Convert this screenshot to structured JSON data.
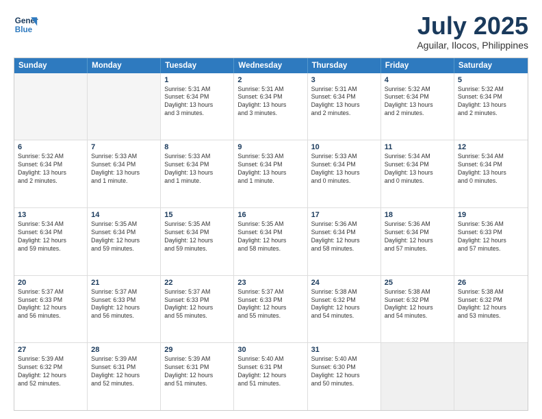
{
  "header": {
    "logo_line1": "General",
    "logo_line2": "Blue",
    "main_title": "July 2025",
    "subtitle": "Aguilar, Ilocos, Philippines"
  },
  "weekdays": [
    "Sunday",
    "Monday",
    "Tuesday",
    "Wednesday",
    "Thursday",
    "Friday",
    "Saturday"
  ],
  "rows": [
    [
      {
        "day": "",
        "lines": [],
        "empty": true
      },
      {
        "day": "",
        "lines": [],
        "empty": true
      },
      {
        "day": "1",
        "lines": [
          "Sunrise: 5:31 AM",
          "Sunset: 6:34 PM",
          "Daylight: 13 hours",
          "and 3 minutes."
        ]
      },
      {
        "day": "2",
        "lines": [
          "Sunrise: 5:31 AM",
          "Sunset: 6:34 PM",
          "Daylight: 13 hours",
          "and 3 minutes."
        ]
      },
      {
        "day": "3",
        "lines": [
          "Sunrise: 5:31 AM",
          "Sunset: 6:34 PM",
          "Daylight: 13 hours",
          "and 2 minutes."
        ]
      },
      {
        "day": "4",
        "lines": [
          "Sunrise: 5:32 AM",
          "Sunset: 6:34 PM",
          "Daylight: 13 hours",
          "and 2 minutes."
        ]
      },
      {
        "day": "5",
        "lines": [
          "Sunrise: 5:32 AM",
          "Sunset: 6:34 PM",
          "Daylight: 13 hours",
          "and 2 minutes."
        ]
      }
    ],
    [
      {
        "day": "6",
        "lines": [
          "Sunrise: 5:32 AM",
          "Sunset: 6:34 PM",
          "Daylight: 13 hours",
          "and 2 minutes."
        ]
      },
      {
        "day": "7",
        "lines": [
          "Sunrise: 5:33 AM",
          "Sunset: 6:34 PM",
          "Daylight: 13 hours",
          "and 1 minute."
        ]
      },
      {
        "day": "8",
        "lines": [
          "Sunrise: 5:33 AM",
          "Sunset: 6:34 PM",
          "Daylight: 13 hours",
          "and 1 minute."
        ]
      },
      {
        "day": "9",
        "lines": [
          "Sunrise: 5:33 AM",
          "Sunset: 6:34 PM",
          "Daylight: 13 hours",
          "and 1 minute."
        ]
      },
      {
        "day": "10",
        "lines": [
          "Sunrise: 5:33 AM",
          "Sunset: 6:34 PM",
          "Daylight: 13 hours",
          "and 0 minutes."
        ]
      },
      {
        "day": "11",
        "lines": [
          "Sunrise: 5:34 AM",
          "Sunset: 6:34 PM",
          "Daylight: 13 hours",
          "and 0 minutes."
        ]
      },
      {
        "day": "12",
        "lines": [
          "Sunrise: 5:34 AM",
          "Sunset: 6:34 PM",
          "Daylight: 13 hours",
          "and 0 minutes."
        ]
      }
    ],
    [
      {
        "day": "13",
        "lines": [
          "Sunrise: 5:34 AM",
          "Sunset: 6:34 PM",
          "Daylight: 12 hours",
          "and 59 minutes."
        ]
      },
      {
        "day": "14",
        "lines": [
          "Sunrise: 5:35 AM",
          "Sunset: 6:34 PM",
          "Daylight: 12 hours",
          "and 59 minutes."
        ]
      },
      {
        "day": "15",
        "lines": [
          "Sunrise: 5:35 AM",
          "Sunset: 6:34 PM",
          "Daylight: 12 hours",
          "and 59 minutes."
        ]
      },
      {
        "day": "16",
        "lines": [
          "Sunrise: 5:35 AM",
          "Sunset: 6:34 PM",
          "Daylight: 12 hours",
          "and 58 minutes."
        ]
      },
      {
        "day": "17",
        "lines": [
          "Sunrise: 5:36 AM",
          "Sunset: 6:34 PM",
          "Daylight: 12 hours",
          "and 58 minutes."
        ]
      },
      {
        "day": "18",
        "lines": [
          "Sunrise: 5:36 AM",
          "Sunset: 6:34 PM",
          "Daylight: 12 hours",
          "and 57 minutes."
        ]
      },
      {
        "day": "19",
        "lines": [
          "Sunrise: 5:36 AM",
          "Sunset: 6:33 PM",
          "Daylight: 12 hours",
          "and 57 minutes."
        ]
      }
    ],
    [
      {
        "day": "20",
        "lines": [
          "Sunrise: 5:37 AM",
          "Sunset: 6:33 PM",
          "Daylight: 12 hours",
          "and 56 minutes."
        ]
      },
      {
        "day": "21",
        "lines": [
          "Sunrise: 5:37 AM",
          "Sunset: 6:33 PM",
          "Daylight: 12 hours",
          "and 56 minutes."
        ]
      },
      {
        "day": "22",
        "lines": [
          "Sunrise: 5:37 AM",
          "Sunset: 6:33 PM",
          "Daylight: 12 hours",
          "and 55 minutes."
        ]
      },
      {
        "day": "23",
        "lines": [
          "Sunrise: 5:37 AM",
          "Sunset: 6:33 PM",
          "Daylight: 12 hours",
          "and 55 minutes."
        ]
      },
      {
        "day": "24",
        "lines": [
          "Sunrise: 5:38 AM",
          "Sunset: 6:32 PM",
          "Daylight: 12 hours",
          "and 54 minutes."
        ]
      },
      {
        "day": "25",
        "lines": [
          "Sunrise: 5:38 AM",
          "Sunset: 6:32 PM",
          "Daylight: 12 hours",
          "and 54 minutes."
        ]
      },
      {
        "day": "26",
        "lines": [
          "Sunrise: 5:38 AM",
          "Sunset: 6:32 PM",
          "Daylight: 12 hours",
          "and 53 minutes."
        ]
      }
    ],
    [
      {
        "day": "27",
        "lines": [
          "Sunrise: 5:39 AM",
          "Sunset: 6:32 PM",
          "Daylight: 12 hours",
          "and 52 minutes."
        ]
      },
      {
        "day": "28",
        "lines": [
          "Sunrise: 5:39 AM",
          "Sunset: 6:31 PM",
          "Daylight: 12 hours",
          "and 52 minutes."
        ]
      },
      {
        "day": "29",
        "lines": [
          "Sunrise: 5:39 AM",
          "Sunset: 6:31 PM",
          "Daylight: 12 hours",
          "and 51 minutes."
        ]
      },
      {
        "day": "30",
        "lines": [
          "Sunrise: 5:40 AM",
          "Sunset: 6:31 PM",
          "Daylight: 12 hours",
          "and 51 minutes."
        ]
      },
      {
        "day": "31",
        "lines": [
          "Sunrise: 5:40 AM",
          "Sunset: 6:30 PM",
          "Daylight: 12 hours",
          "and 50 minutes."
        ]
      },
      {
        "day": "",
        "lines": [],
        "empty": true,
        "shaded": true
      },
      {
        "day": "",
        "lines": [],
        "empty": true,
        "shaded": true
      }
    ]
  ]
}
